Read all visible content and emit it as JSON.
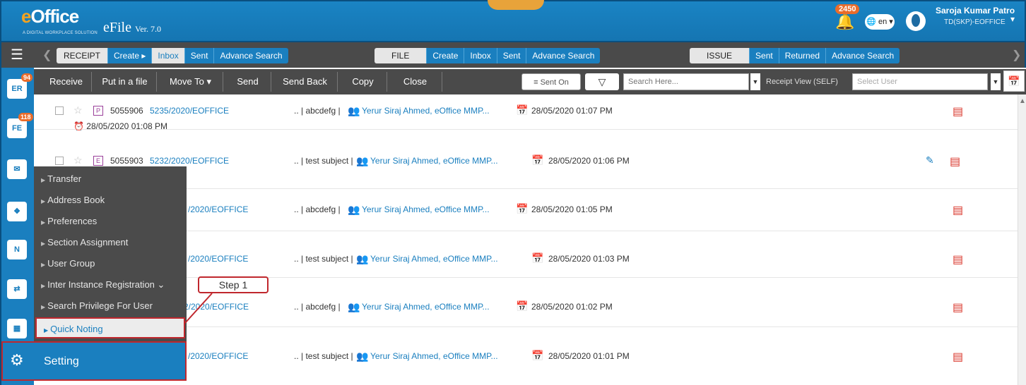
{
  "header": {
    "logo_text": "eOffice",
    "logo_tag": "A DIGITAL WORKPLACE SOLUTION",
    "app_name": "eFile",
    "version": "Ver. 7.0",
    "notification_count": "2450",
    "language": "en",
    "user_name": "Saroja Kumar Patro",
    "user_org": "TD(SKP)-EOFFICE"
  },
  "menubar": {
    "receipt": {
      "label": "RECEIPT",
      "items": [
        "Create",
        "Inbox",
        "Sent",
        "Advance Search"
      ],
      "active": "Inbox"
    },
    "file": {
      "label": "FILE",
      "items": [
        "Create",
        "Inbox",
        "Sent",
        "Advance Search"
      ]
    },
    "issue": {
      "label": "ISSUE",
      "items": [
        "Sent",
        "Returned",
        "Advance Search"
      ]
    }
  },
  "toolbar": {
    "buttons": [
      "Receive",
      "Put in a file",
      "Move To",
      "Send",
      "Send Back",
      "Copy",
      "Close"
    ],
    "sent_on": "Sent On",
    "search_placeholder": "Search Here...",
    "receipt_view": "Receipt View (SELF)",
    "select_user_placeholder": "Select User"
  },
  "rail": {
    "badges": {
      "er": "94",
      "fe": "118"
    }
  },
  "rows": [
    {
      "type": "P",
      "num": "5055906",
      "file_no": "5235/2020/EOFFICE",
      "subject": "abcdefg",
      "sender": "Yerur Siraj Ahmed, eOffice MMP...",
      "date": "28/05/2020 01:07 PM",
      "due": "28/05/2020 01:08 PM"
    },
    {
      "type": "E",
      "num": "5055903",
      "file_no": "5232/2020/EOFFICE",
      "subject": "test subject",
      "sender": "Yerur Siraj Ahmed, eOffice MMP...",
      "date": "28/05/2020 01:06 PM"
    },
    {
      "file_no": "/2020/EOFFICE",
      "subject": "abcdefg",
      "sender": "Yerur Siraj Ahmed, eOffice MMP...",
      "date": "28/05/2020 01:05 PM"
    },
    {
      "file_no": "/2020/EOFFICE",
      "subject": "test subject",
      "sender": "Yerur Siraj Ahmed, eOffice MMP...",
      "date": "28/05/2020 01:03 PM"
    },
    {
      "file_no": "2/2020/EOFFICE",
      "subject": "abcdefg",
      "sender": "Yerur Siraj Ahmed, eOffice MMP...",
      "date": "28/05/2020 01:02 PM"
    },
    {
      "file_no": "/2020/EOFFICE",
      "subject": "test subject",
      "sender": "Yerur Siraj Ahmed, eOffice MMP...",
      "date": "28/05/2020 01:01 PM"
    }
  ],
  "popup_menu": {
    "items": [
      "Transfer",
      "Address Book",
      "Preferences",
      "Section Assignment",
      "User Group",
      "Inter Instance Registration",
      "Search Privilege For User"
    ],
    "quick_noting": "Quick Noting",
    "setting": "Setting"
  },
  "callout": "Step 1",
  "colors": {
    "primary": "#1a7fbf",
    "toolbar": "#4a4a4a",
    "highlight": "#c0272d",
    "pdf": "#d9362b"
  }
}
